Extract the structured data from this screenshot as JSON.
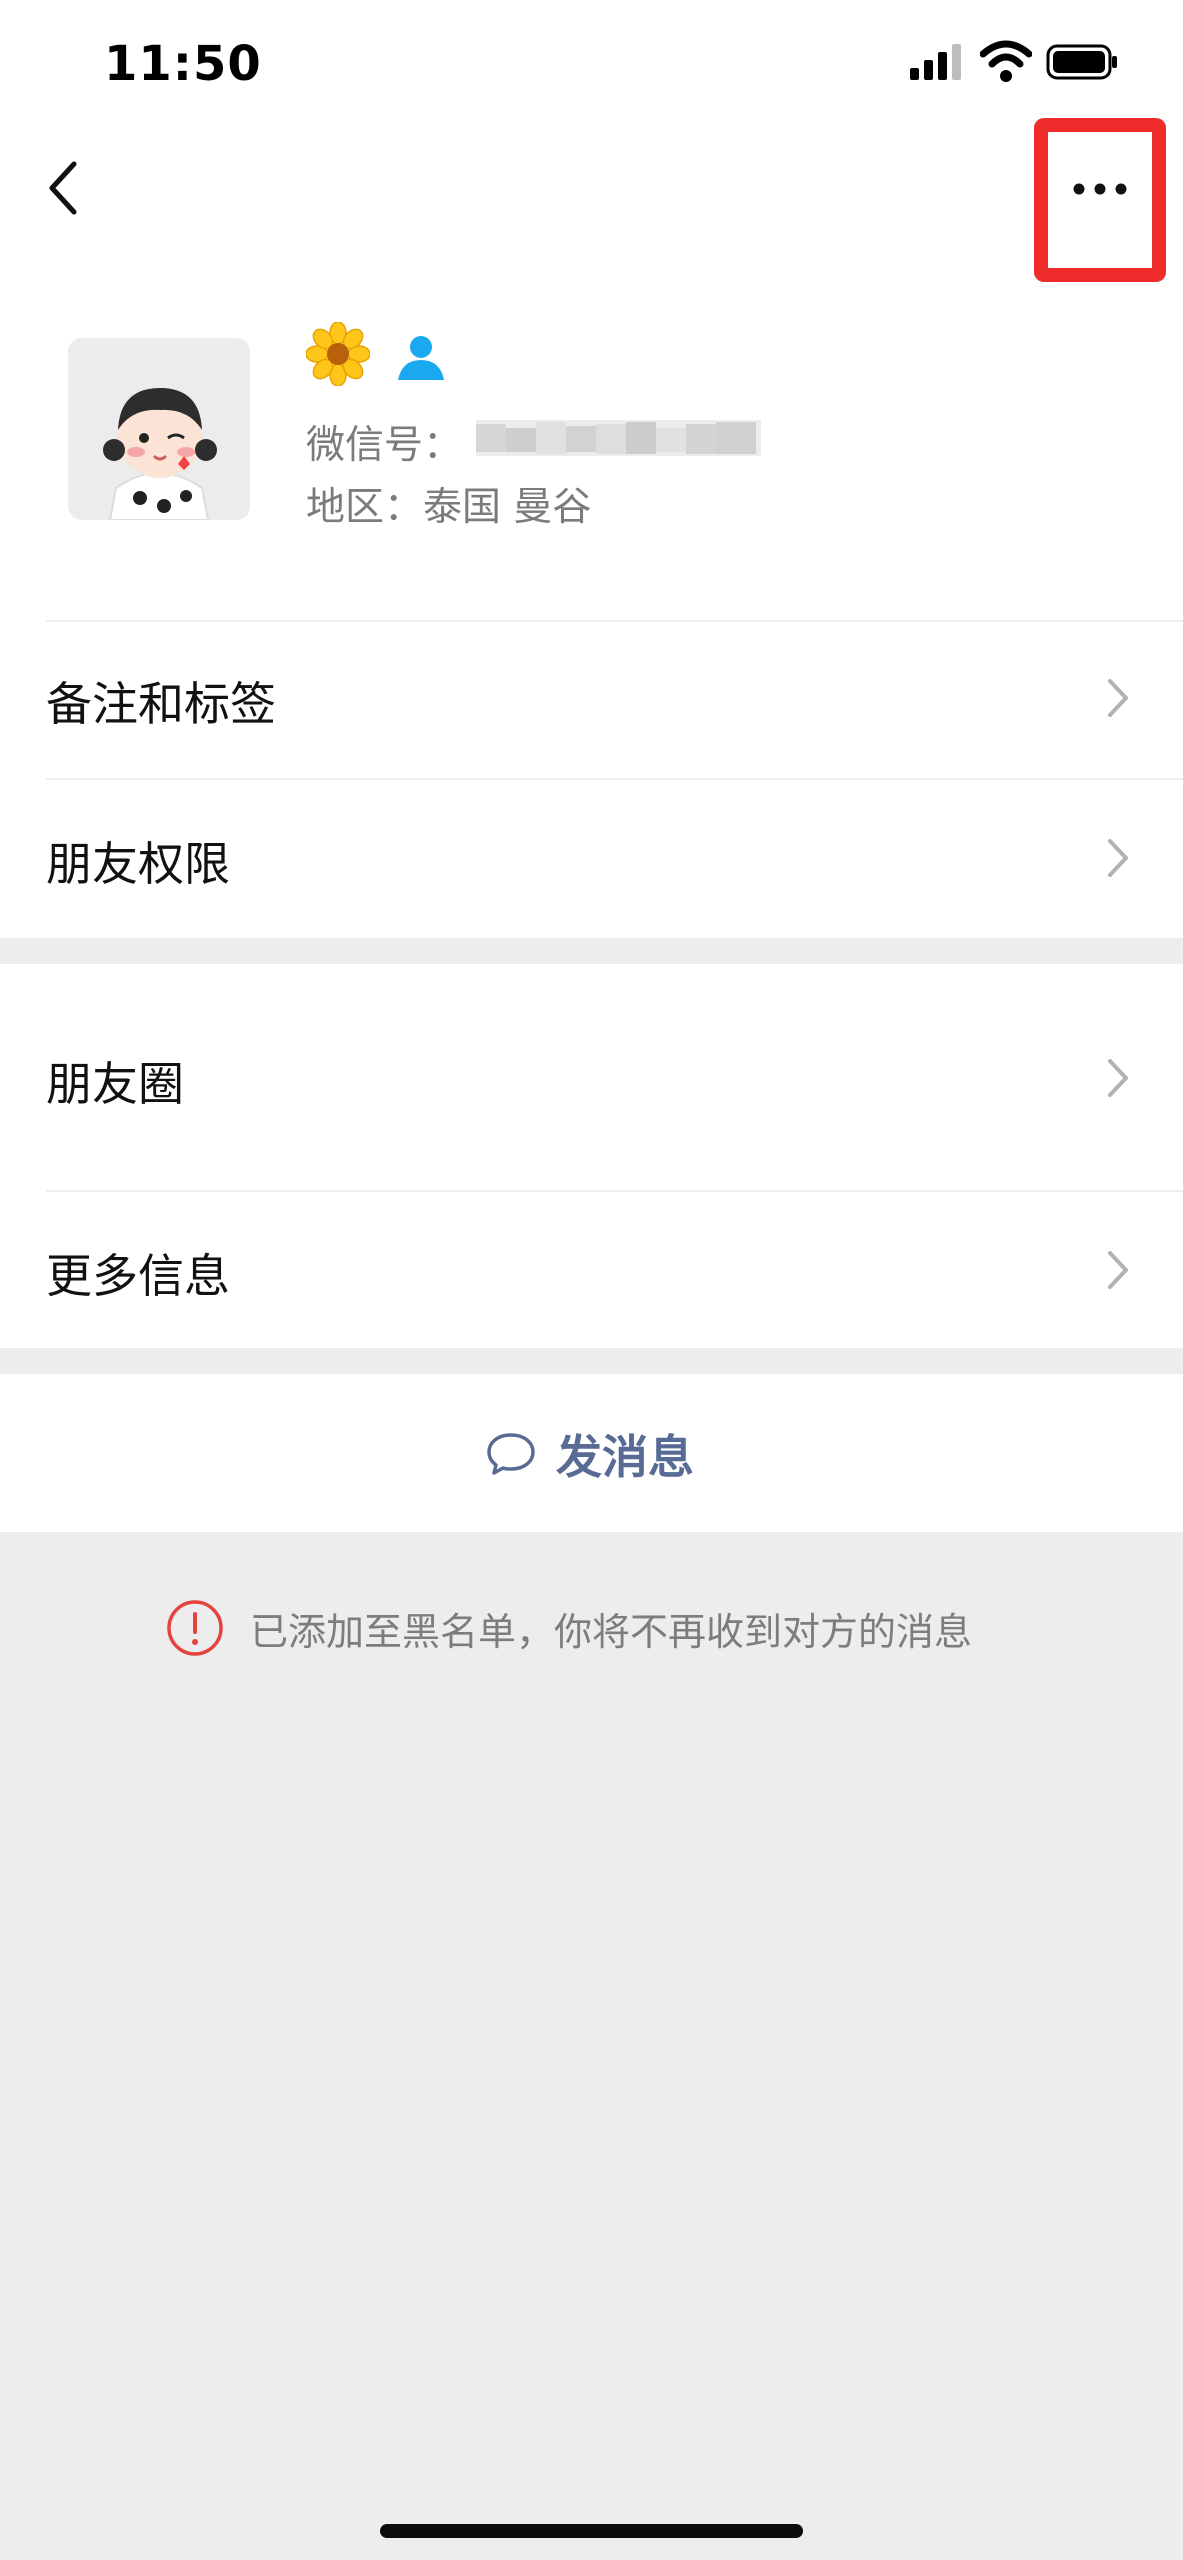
{
  "status_bar": {
    "time": "11:50"
  },
  "profile": {
    "wechat_id_label": "微信号：",
    "region": "地区：泰国 曼谷"
  },
  "menu": [
    {
      "label": "备注和标签"
    },
    {
      "label": "朋友权限"
    },
    {
      "label": "朋友圈"
    },
    {
      "label": "更多信息"
    }
  ],
  "send_message": {
    "label": "发消息"
  },
  "notice": {
    "text": "已添加至黑名单，你将不再收到对方的消息"
  },
  "colors": {
    "highlight": "#ef2b2b",
    "link": "#576b95",
    "warning": "#e64340"
  }
}
